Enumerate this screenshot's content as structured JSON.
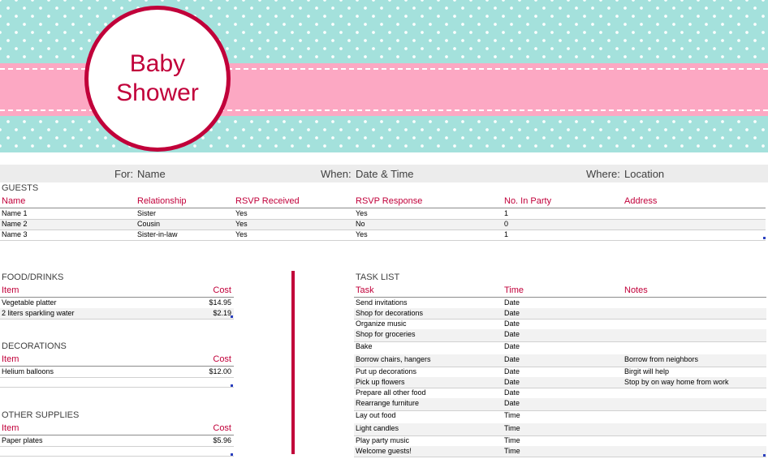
{
  "banner": {
    "title_line1": "Baby",
    "title_line2": "Shower"
  },
  "event": {
    "for_label": "For:",
    "for_value": "Name",
    "when_label": "When:",
    "when_value": "Date & Time",
    "where_label": "Where:",
    "where_value": "Location"
  },
  "guests": {
    "title": "GUESTS",
    "headers": [
      "Name",
      "Relationship",
      "RSVP Received",
      "RSVP Response",
      "No. In Party",
      "Address"
    ],
    "rows": [
      [
        "Name 1",
        "Sister",
        "Yes",
        "Yes",
        "1",
        ""
      ],
      [
        "Name 2",
        "Cousin",
        "Yes",
        "No",
        "0",
        ""
      ],
      [
        "Name 3",
        "Sister-in-law",
        "Yes",
        "Yes",
        "1",
        ""
      ]
    ]
  },
  "food": {
    "title": "FOOD/DRINKS",
    "item_header": "Item",
    "cost_header": "Cost",
    "rows": [
      [
        "Vegetable platter",
        "$14.95"
      ],
      [
        "2 liters sparkling water",
        "$2.19"
      ]
    ]
  },
  "decorations": {
    "title": "DECORATIONS",
    "item_header": "Item",
    "cost_header": "Cost",
    "rows": [
      [
        "Helium balloons",
        "$12.00"
      ]
    ]
  },
  "supplies": {
    "title": "OTHER SUPPLIES",
    "item_header": "Item",
    "cost_header": "Cost",
    "rows": [
      [
        "Paper plates",
        "$5.96"
      ]
    ]
  },
  "tasks": {
    "title": "TASK LIST",
    "headers": [
      "Task",
      "Time",
      "Notes"
    ],
    "rows": [
      [
        "Send invitations",
        "Date",
        ""
      ],
      [
        "Shop for decorations",
        "Date",
        ""
      ],
      [
        "Organize music",
        "Date",
        ""
      ],
      [
        "Shop for groceries",
        "Date",
        ""
      ],
      [
        "Bake",
        "Date",
        ""
      ],
      [
        "Borrow chairs, hangers",
        "Date",
        "Borrow from neighbors"
      ],
      [
        "Put up decorations",
        "Date",
        "Birgit will help"
      ],
      [
        "Pick up flowers",
        "Date",
        "Stop by on way home from work"
      ],
      [
        "Prepare all other food",
        "Date",
        ""
      ],
      [
        "Rearrange furniture",
        "Date",
        ""
      ],
      [
        "Lay out food",
        "Time",
        ""
      ],
      [
        "Light candles",
        "Time",
        ""
      ],
      [
        "Play party music",
        "Time",
        ""
      ],
      [
        "Welcome guests!",
        "Time",
        ""
      ]
    ]
  },
  "colors": {
    "accent": "#c1003a",
    "teal": "#a4e1dc",
    "pink": "#fca8c3"
  }
}
